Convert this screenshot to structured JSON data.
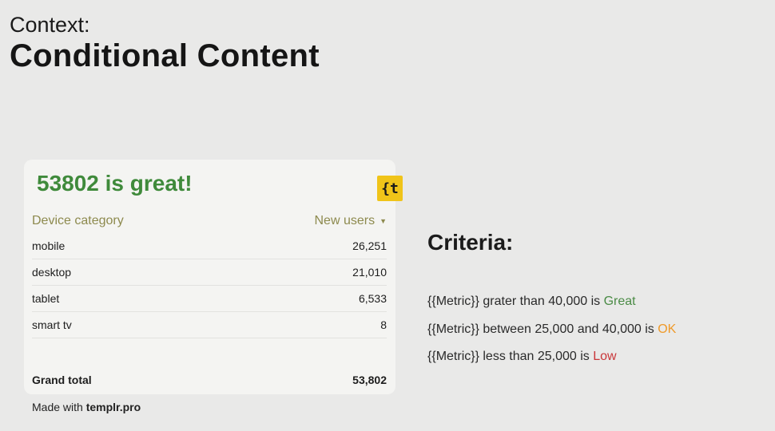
{
  "header": {
    "context": "Context:",
    "title": "Conditional Content"
  },
  "card": {
    "headline": "53802 is great!",
    "logo_text": "{t",
    "logo_icon": "templr-logo-icon",
    "table": {
      "columns": [
        "Device category",
        "New users"
      ],
      "sort_icon": "▼",
      "rows": [
        {
          "category": "mobile",
          "value": "26,251"
        },
        {
          "category": "desktop",
          "value": "21,010"
        },
        {
          "category": "tablet",
          "value": "6,533"
        },
        {
          "category": "smart tv",
          "value": "8"
        }
      ],
      "total_label": "Grand total",
      "total_value": "53,802"
    }
  },
  "footer": {
    "made_with_prefix": "Made with",
    "made_with_brand": "templr.pro"
  },
  "criteria": {
    "title": "Criteria:",
    "lines": [
      {
        "text": "{{Metric}} grater than 40,000 is ",
        "status": "Great"
      },
      {
        "text": "{{Metric}} between 25,000 and 40,000 is ",
        "status": "OK"
      },
      {
        "text": "{{Metric}} less than 25,000 is ",
        "status": "Low"
      }
    ]
  },
  "colors": {
    "great": "#4a8b45",
    "ok": "#ef9a2a",
    "low": "#c9373a",
    "headline": "#3f8a3b",
    "logo_bg": "#f0c419"
  }
}
